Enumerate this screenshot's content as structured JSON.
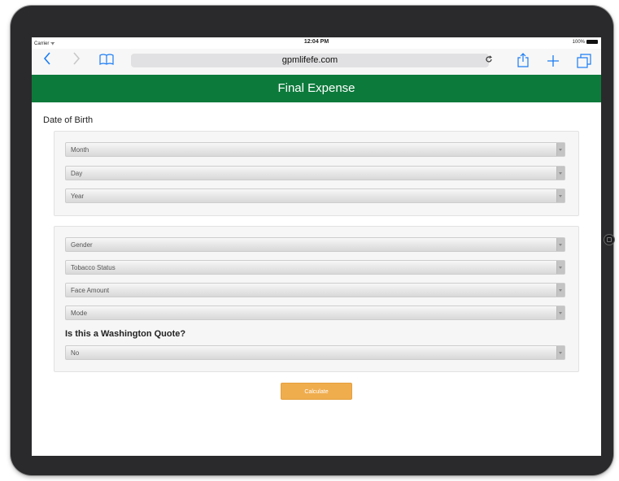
{
  "status_bar": {
    "carrier": "Carrier ᯤ",
    "time": "12:04 PM",
    "battery": "100%"
  },
  "browser": {
    "url": "gpmlifefe.com",
    "back_icon": "chevron-left-icon",
    "forward_icon": "chevron-right-icon",
    "bookmarks_icon": "book-icon",
    "reload_icon": "reload-icon",
    "share_icon": "share-icon",
    "new_tab_icon": "plus-icon",
    "tabs_icon": "tabs-icon",
    "accent_color": "#1a7cf4"
  },
  "header": {
    "title": "Final Expense",
    "color": "#0c7a3b"
  },
  "form": {
    "dob_label": "Date of Birth",
    "month": "Month",
    "day": "Day",
    "year": "Year",
    "gender": "Gender",
    "tobacco": "Tobacco Status",
    "face_amount": "Face Amount",
    "mode": "Mode",
    "washington_label": "Is this a Washington Quote?",
    "washington_value": "No",
    "calculate_label": "Calculate",
    "button_color": "#f0ad4e"
  }
}
